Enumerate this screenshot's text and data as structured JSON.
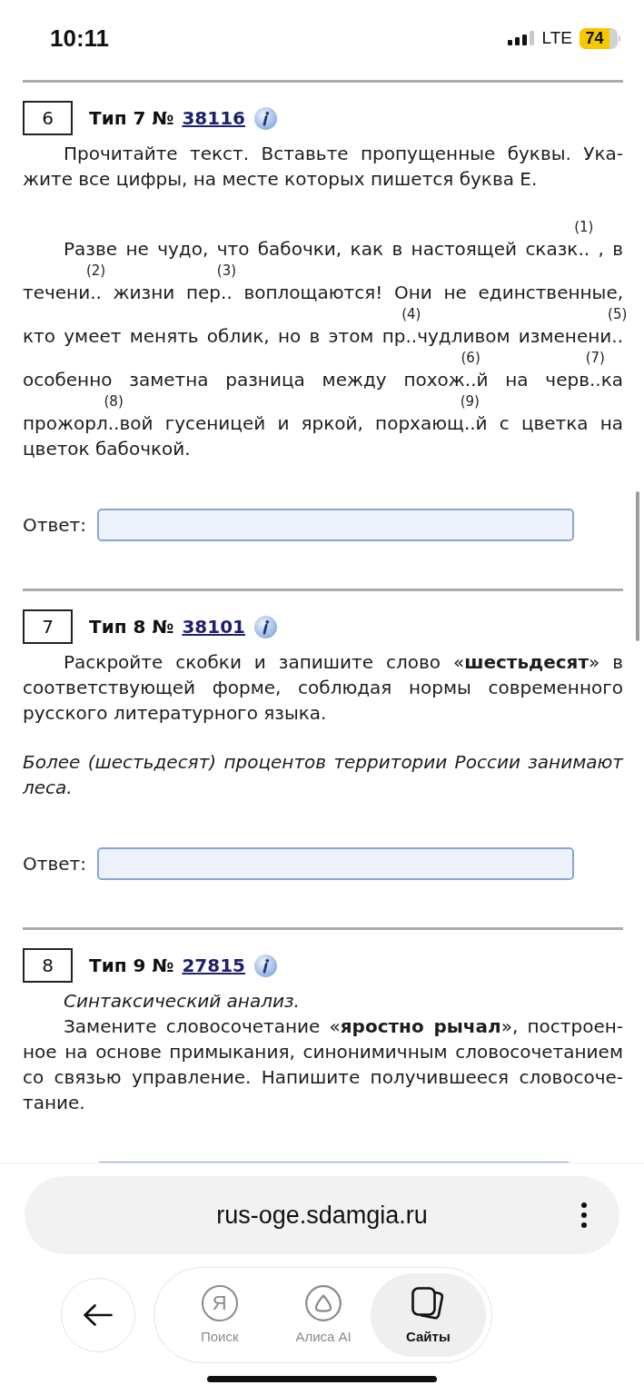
{
  "status_bar": {
    "time": "10:11",
    "network": "LTE",
    "battery": "74"
  },
  "tasks": [
    {
      "number": "6",
      "heading": "Тип 7 №",
      "link": "38116",
      "paragraphs": [
        {
          "kind": "instruction",
          "text": "Прочитайте текст. Вставьте пропущенные буквы. Ука-жите все цифры, на месте которых пишется буква Е."
        },
        {
          "kind": "passage",
          "parts": [
            {
              "text": "Разве не чудо, что бабочки, как в настоящей сказк",
              "gap": "..",
              "mark": "(1)"
            },
            {
              "text": " , в течени",
              "gap": "..",
              "mark": "(2)"
            },
            {
              "text": " жизни пер",
              "gap": "..",
              "mark": "(3)"
            },
            {
              "text": " воплощаются! Они не единственные, кто умеет менять облик, но в этом пр",
              "gap": "..",
              "mark": "(4)"
            },
            {
              "text": "чудливом изменени",
              "gap": "..",
              "mark": "(5)"
            },
            {
              "text": " особенно заметна разница между похож",
              "gap": "..",
              "mark": "(6)"
            },
            {
              "text": "й на черв",
              "gap": "..",
              "mark": "(7)"
            },
            {
              "text": "ка прожорл",
              "gap": "..",
              "mark": "(8)"
            },
            {
              "text": "вой гусеницей и яркой, порхающ",
              "gap": "..",
              "mark": "(9)"
            },
            {
              "text": "й с цветка на цветок бабочкой."
            }
          ]
        }
      ],
      "answer": {
        "label": "Ответ:",
        "cut_off": false
      }
    },
    {
      "number": "7",
      "heading": "Тип 8 №",
      "link": "38101",
      "paragraphs": [
        {
          "kind": "instruction",
          "text": "Раскройте скобки и запишите слово «**шестьдесят**» в соответствующей форме, соблюдая нормы современного русского литературного языка."
        },
        {
          "kind": "example",
          "text": "Более (шестьдесят) процентов территории России занимают леса."
        }
      ],
      "answer": {
        "label": "Ответ:",
        "cut_off": false
      }
    },
    {
      "number": "8",
      "heading": "Тип 9 №",
      "link": "27815",
      "paragraphs": [
        {
          "kind": "subtitle",
          "text": "Синтаксический анализ."
        },
        {
          "kind": "instruction",
          "text": "Замените словосочетание «**яростно рычал**», построен-ное на основе примыкания, синонимичным словосочетанием со связью управление. Напишите получившееся словосоче-тание."
        }
      ],
      "answer": {
        "cut_off": true
      }
    }
  ],
  "browser": {
    "url": "rus-oge.sdamgia.ru",
    "tabs": [
      {
        "kind": "search",
        "glyph": "Я",
        "label": "Поиск",
        "selected": false
      },
      {
        "kind": "assistant",
        "label": "Алиса AI",
        "selected": false
      },
      {
        "kind": "tabs",
        "label": "Сайты",
        "selected": true
      }
    ]
  }
}
